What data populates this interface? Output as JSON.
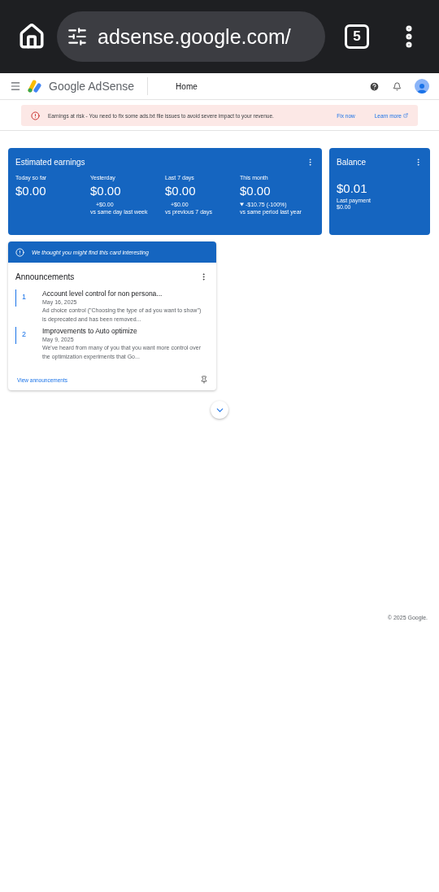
{
  "browser": {
    "url": "adsense.google.com/",
    "tab_count": "5"
  },
  "header": {
    "brand": "Google AdSense",
    "page": "Home"
  },
  "alert": {
    "message": "Earnings at risk - You need to fix some ads.txt file issues to avoid severe impact to your revenue.",
    "actions": [
      "Fix now",
      "Learn more"
    ]
  },
  "earnings": {
    "title": "Estimated earnings",
    "metrics": [
      {
        "label": "Today so far",
        "value": "$0.00"
      },
      {
        "label": "Yesterday",
        "value": "$0.00",
        "change": "+$0.00",
        "compare": "vs same day last week",
        "down": false
      },
      {
        "label": "Last 7 days",
        "value": "$0.00",
        "change": "+$0.00",
        "compare": "vs previous 7 days",
        "down": false
      },
      {
        "label": "This month",
        "value": "$0.00",
        "change": "-$10.75 (-100%)",
        "compare": "vs same period last year",
        "down": true
      }
    ]
  },
  "balance": {
    "title": "Balance",
    "value": "$0.01",
    "last_payment_label": "Last payment",
    "last_payment": "$0.00"
  },
  "suggestion": {
    "banner": "We thought you might find this card interesting",
    "title": "Announcements",
    "items": [
      {
        "number": "1",
        "title": "Account level control for non persona...",
        "date": "May 16, 2025",
        "text": "Ad choice control (\"Choosing the type of ad you want to show\") is deprecated and has been removed..."
      },
      {
        "number": "2",
        "title": "Improvements to Auto optimize",
        "date": "May 9, 2025",
        "text": "We've heard from many of you that you want more control over the optimization experiments that Go..."
      }
    ],
    "link": "View announcements"
  },
  "footer": "© 2025 Google."
}
